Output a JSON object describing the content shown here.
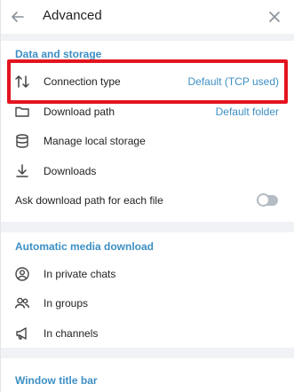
{
  "header": {
    "title": "Advanced",
    "back_icon": "arrow-left-icon",
    "close_icon": "close-icon"
  },
  "data_storage": {
    "title": "Data and storage",
    "items": [
      {
        "label": "Connection type",
        "value": "Default (TCP used)",
        "icon": "arrows-up-down-icon"
      },
      {
        "label": "Download path",
        "value": "Default folder",
        "icon": "folder-icon"
      },
      {
        "label": "Manage local storage",
        "icon": "database-icon"
      },
      {
        "label": "Downloads",
        "icon": "download-icon"
      }
    ],
    "ask_path": {
      "label": "Ask download path for each file",
      "enabled": false
    }
  },
  "media_download": {
    "title": "Automatic media download",
    "items": [
      {
        "label": "In private chats",
        "icon": "user-icon"
      },
      {
        "label": "In groups",
        "icon": "group-icon"
      },
      {
        "label": "In channels",
        "icon": "megaphone-icon"
      }
    ]
  },
  "window_title_bar": {
    "title": "Window title bar"
  },
  "colors": {
    "accent": "#3d8fc4",
    "highlight": "#e3141f"
  }
}
